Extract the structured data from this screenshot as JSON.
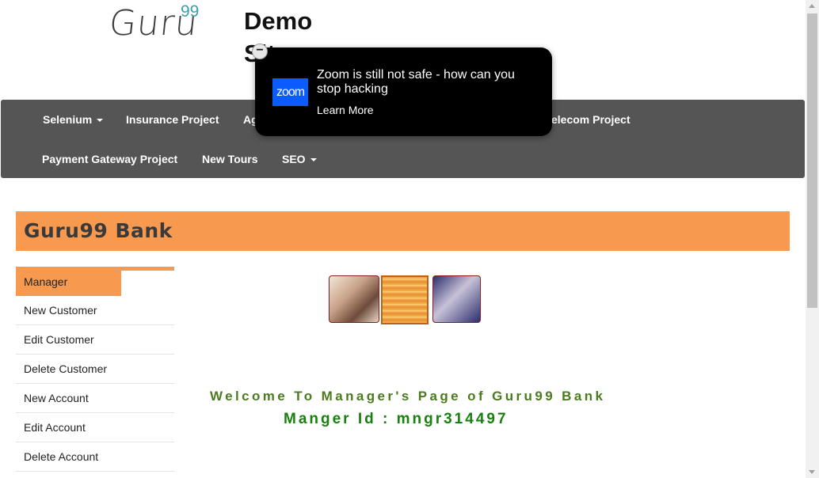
{
  "header": {
    "logo_text": "Guru",
    "logo_sup": "99",
    "demo_title": "Demo Site"
  },
  "nav": {
    "row1": [
      {
        "label": "Selenium",
        "dropdown": true
      },
      {
        "label": "Insurance Project",
        "dropdown": false
      },
      {
        "label": "Ag",
        "dropdown": false
      },
      {
        "label": "elecom Project",
        "dropdown": false
      }
    ],
    "row2": [
      {
        "label": "Payment Gateway Project",
        "dropdown": false
      },
      {
        "label": "New Tours",
        "dropdown": false
      },
      {
        "label": "SEO",
        "dropdown": true
      }
    ]
  },
  "ad": {
    "close_symbol": "−",
    "logo_text": "zoom",
    "title": "Zoom is still not safe - how can you stop hacking",
    "link": "Learn More"
  },
  "bank": {
    "title": "Guru99 Bank"
  },
  "sidebar": {
    "items": [
      {
        "label": "Manager",
        "active": true
      },
      {
        "label": "New Customer",
        "active": false
      },
      {
        "label": "Edit Customer",
        "active": false
      },
      {
        "label": "Delete Customer",
        "active": false
      },
      {
        "label": "New Account",
        "active": false
      },
      {
        "label": "Edit Account",
        "active": false
      },
      {
        "label": "Delete Account",
        "active": false
      }
    ]
  },
  "main": {
    "welcome": "Welcome To Manager's Page of Guru99 Bank",
    "manager_id": "Manger Id : mngr314497"
  },
  "colors": {
    "accent": "#f79a50",
    "nav_bg": "#555555",
    "welcome_green": "#4a7b1f",
    "id_green": "#18800f"
  }
}
